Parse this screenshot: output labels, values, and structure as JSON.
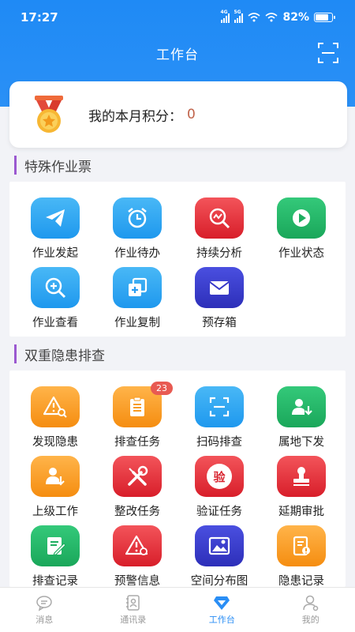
{
  "status": {
    "time": "17:27",
    "sig1": "4G",
    "sig2": "5G",
    "battery": "82%",
    "battery_level": 0.82
  },
  "header": {
    "title": "工作台"
  },
  "points": {
    "label": "我的本月积分：",
    "value": "0"
  },
  "sections": [
    {
      "title": "特殊作业票",
      "items": [
        {
          "label": "作业发起",
          "icon": "paper-plane-icon",
          "color": "blue"
        },
        {
          "label": "作业待办",
          "icon": "alarm-clock-icon",
          "color": "blue"
        },
        {
          "label": "持续分析",
          "icon": "analysis-magnifier-icon",
          "color": "red"
        },
        {
          "label": "作业状态",
          "icon": "play-icon",
          "color": "green"
        },
        {
          "label": "作业查看",
          "icon": "zoom-in-icon",
          "color": "blue"
        },
        {
          "label": "作业复制",
          "icon": "copy-icon",
          "color": "blue"
        },
        {
          "label": "预存箱",
          "icon": "envelope-icon",
          "color": "purple"
        }
      ]
    },
    {
      "title": "双重隐患排查",
      "items": [
        {
          "label": "发现隐患",
          "icon": "warning-search-icon",
          "color": "orange"
        },
        {
          "label": "排查任务",
          "icon": "clipboard-list-icon",
          "color": "orange",
          "badge": "23"
        },
        {
          "label": "扫码排查",
          "icon": "scan-icon",
          "color": "blue"
        },
        {
          "label": "属地下发",
          "icon": "user-download-icon",
          "color": "green"
        },
        {
          "label": "上级工作",
          "icon": "user-task-icon",
          "color": "orange"
        },
        {
          "label": "整改任务",
          "icon": "tools-icon",
          "color": "red"
        },
        {
          "label": "验证任务",
          "icon": "verify-stamp-icon",
          "color": "red"
        },
        {
          "label": "延期审批",
          "icon": "seal-icon",
          "color": "red"
        },
        {
          "label": "排查记录",
          "icon": "edit-record-icon",
          "color": "green"
        },
        {
          "label": "预警信息",
          "icon": "alert-triangle-icon",
          "color": "red"
        },
        {
          "label": "空间分布图",
          "icon": "image-map-icon",
          "color": "purple"
        },
        {
          "label": "隐患记录",
          "icon": "document-alert-icon",
          "color": "orange"
        }
      ]
    }
  ],
  "verify_glyph": "验",
  "nav": [
    {
      "label": "消息",
      "icon": "message-icon",
      "active": false
    },
    {
      "label": "通讯录",
      "icon": "contacts-icon",
      "active": false
    },
    {
      "label": "工作台",
      "icon": "workbench-icon",
      "active": true
    },
    {
      "label": "我的",
      "icon": "profile-icon",
      "active": false
    }
  ],
  "colors": {
    "primary": "#2a8ef5",
    "points_value": "#c0634a",
    "section_bar": "#9b59d0",
    "badge": "#e85a52"
  }
}
